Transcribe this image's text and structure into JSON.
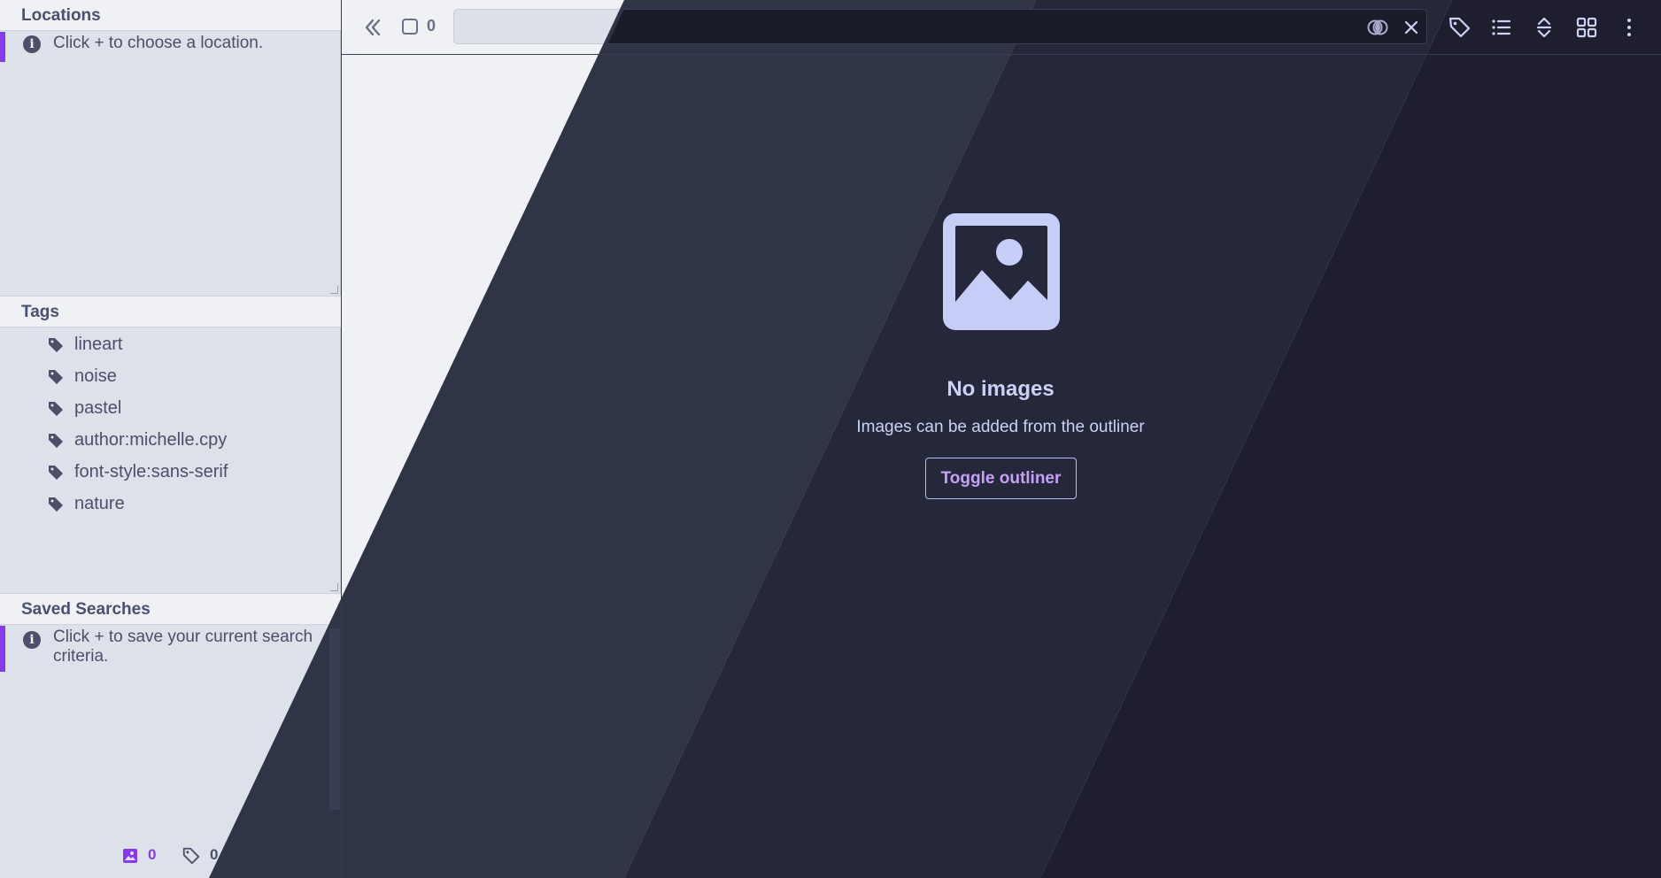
{
  "sidebar": {
    "locations": {
      "title": "Locations",
      "info": "Click + to choose a location."
    },
    "tags": {
      "title": "Tags",
      "items": [
        "lineart",
        "noise",
        "pastel",
        "author:michelle.cpy",
        "font-style:sans-serif",
        "nature"
      ]
    },
    "saved_searches": {
      "title": "Saved Searches",
      "info": "Click + to save your current search criteria."
    },
    "footer": {
      "image_count": "0",
      "tag_count": "0"
    }
  },
  "toolbar": {
    "selection_count": "0",
    "search_value": ""
  },
  "empty_state": {
    "title": "No images",
    "subtitle": "Images can be added from the outliner",
    "button": "Toggle outliner"
  },
  "colors": {
    "accent": "#8839ef",
    "dark_band_1": "#303447",
    "dark_band_2": "#25273a",
    "dark_band_3": "#1e1e2e",
    "light_bg": "#eff1f5",
    "sidebar_bg": "#dde1e9"
  }
}
